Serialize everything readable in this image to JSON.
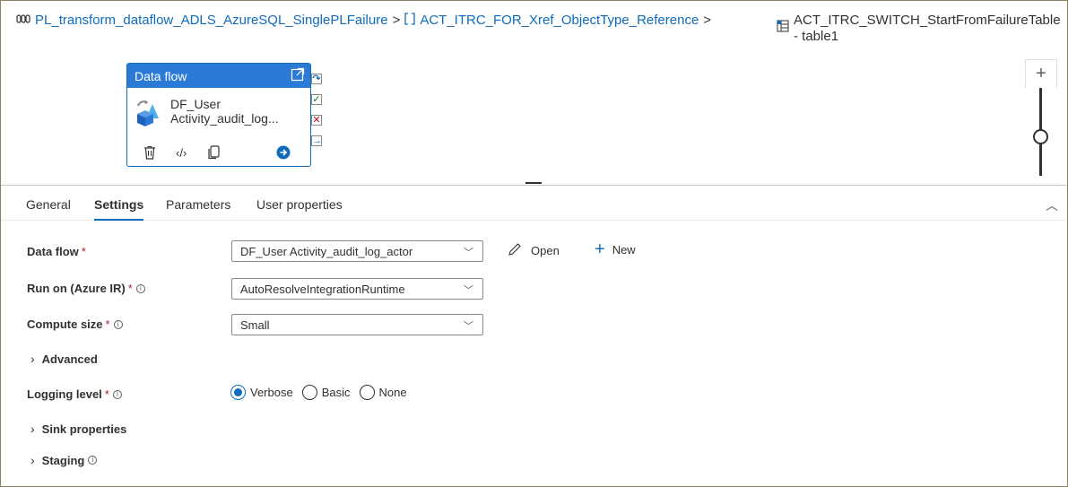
{
  "breadcrumb": {
    "pipeline": "PL_transform_dataflow_ADLS_AzureSQL_SinglePLFailure",
    "foreach": "ACT_ITRC_FOR_Xref_ObjectType_Reference",
    "switch_line1": "ACT_ITRC_SWITCH_StartFromFailureTable",
    "switch_line2": "- table1",
    "separator": ">"
  },
  "canvas": {
    "activity": {
      "type_label": "Data flow",
      "name_line1": "DF_User",
      "name_line2": "Activity_audit_log..."
    },
    "zoom_plus": "+"
  },
  "tabs": [
    {
      "label": "General"
    },
    {
      "label": "Settings"
    },
    {
      "label": "Parameters"
    },
    {
      "label": "User properties"
    }
  ],
  "form": {
    "dataflow_label": "Data flow",
    "dataflow_value": "DF_User Activity_audit_log_actor",
    "open_label": "Open",
    "new_label": "New",
    "runon_label": "Run on (Azure IR)",
    "runon_value": "AutoResolveIntegrationRuntime",
    "compute_label": "Compute size",
    "compute_value": "Small",
    "advanced_label": "Advanced",
    "logging_label": "Logging level",
    "logging_options": [
      "Verbose",
      "Basic",
      "None"
    ],
    "logging_selected": "Verbose",
    "sink_label": "Sink properties",
    "staging_label": "Staging",
    "required_mark": "*"
  },
  "colors": {
    "accent": "#0f6cbd",
    "card_header": "#2b7bd6",
    "success": "#107c10",
    "failure": "#c50f1f"
  }
}
